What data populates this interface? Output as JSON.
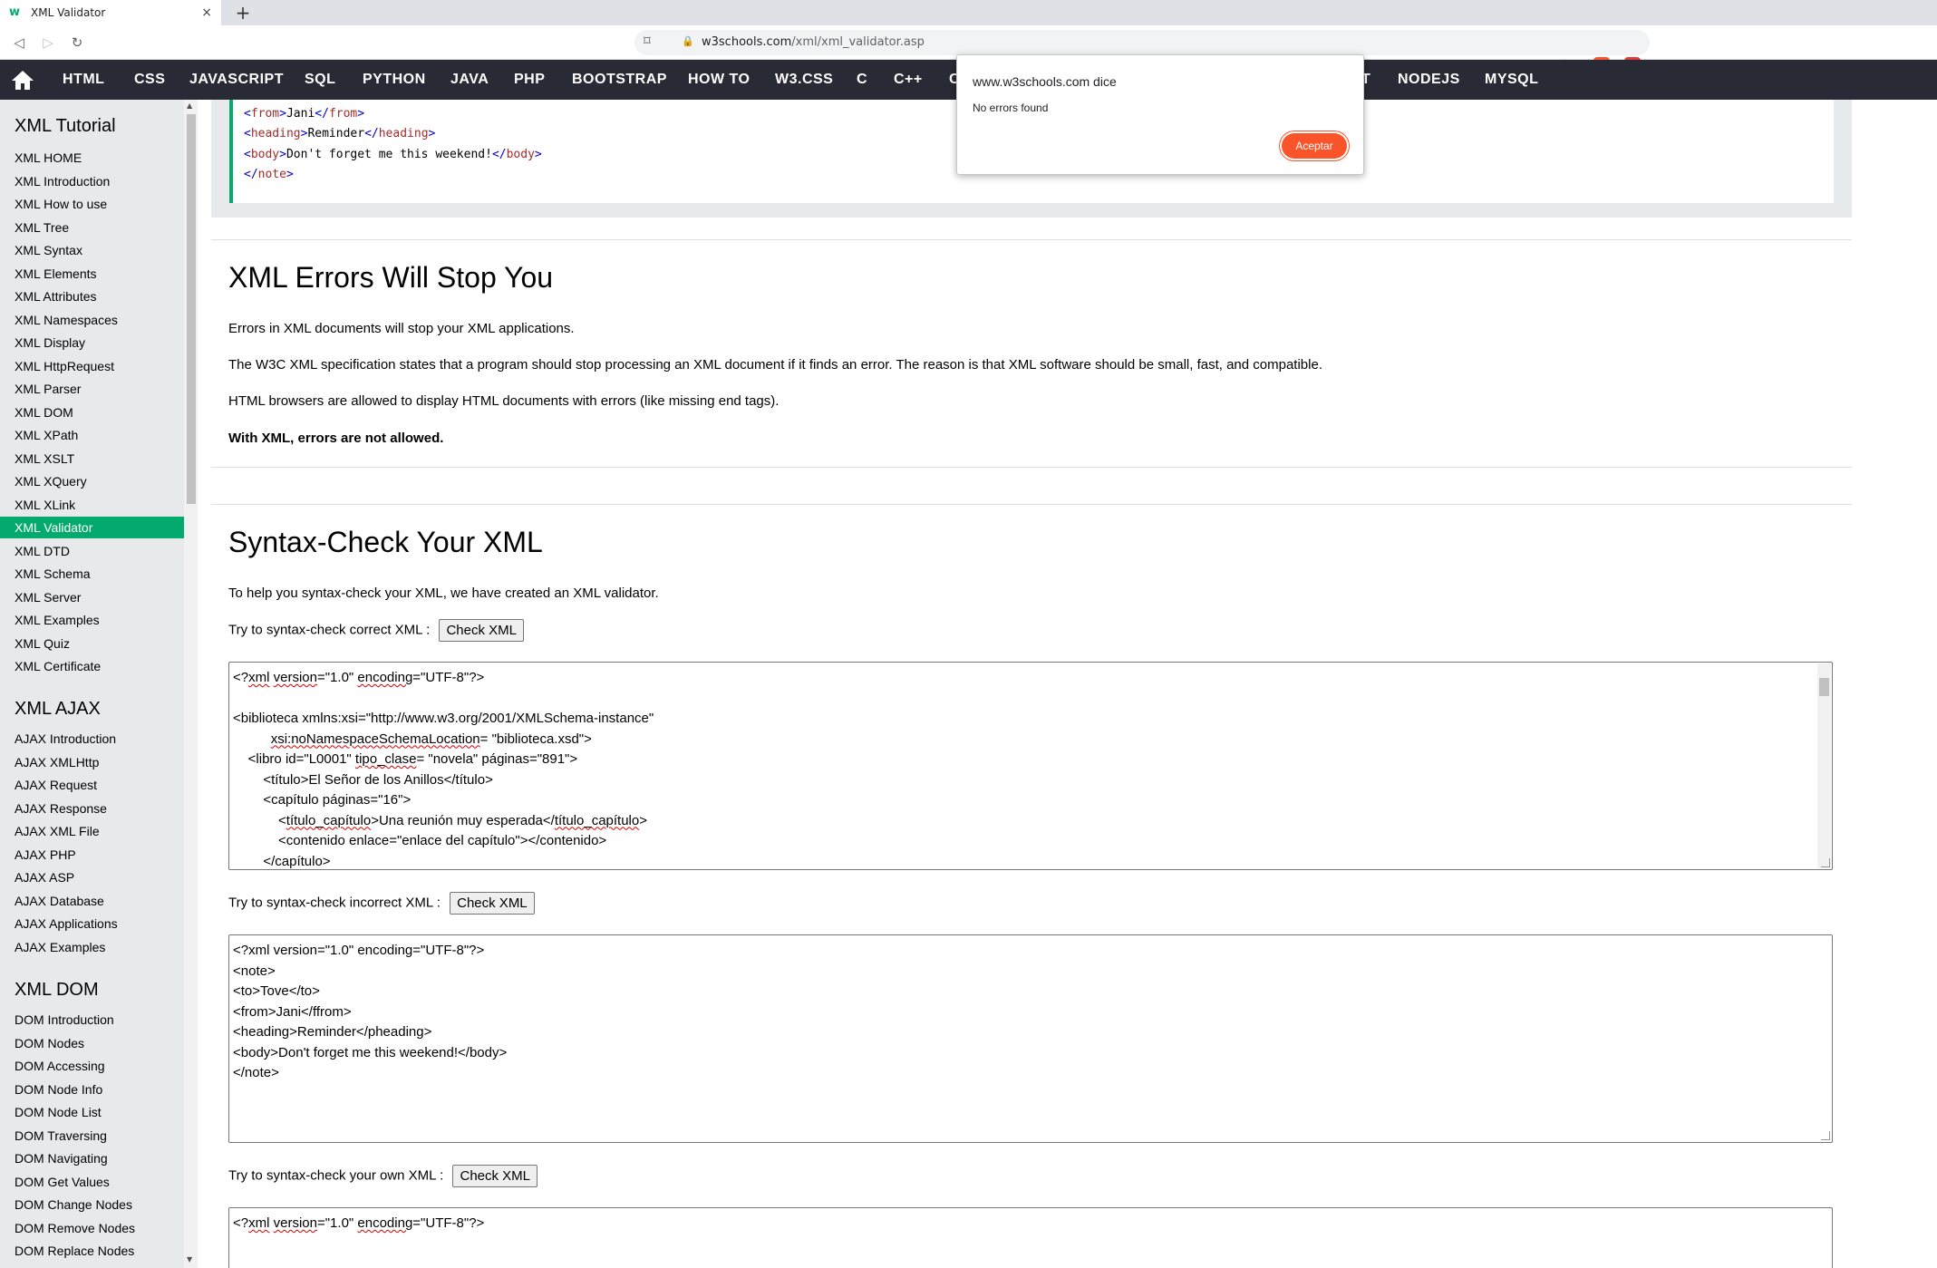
{
  "browser": {
    "tab_title": "XML Validator",
    "tab_close": "×",
    "new_tab": "+",
    "url_host": "w3schools.com",
    "url_path": "/xml/xml_validator.asp"
  },
  "topnav": {
    "items": [
      "HTML",
      "CSS",
      "JAVASCRIPT",
      "SQL",
      "PYTHON",
      "JAVA",
      "PHP",
      "BOOTSTRAP",
      "HOW TO",
      "W3.CSS",
      "C",
      "C++",
      "C",
      "T",
      "NODEJS",
      "MYSQL"
    ]
  },
  "sidebar": {
    "xml_tutorial_title": "XML Tutorial",
    "xml_items": [
      "XML HOME",
      "XML Introduction",
      "XML How to use",
      "XML Tree",
      "XML Syntax",
      "XML Elements",
      "XML Attributes",
      "XML Namespaces",
      "XML Display",
      "XML HttpRequest",
      "XML Parser",
      "XML DOM",
      "XML XPath",
      "XML XSLT",
      "XML XQuery",
      "XML XLink",
      "XML Validator",
      "XML DTD",
      "XML Schema",
      "XML Server",
      "XML Examples",
      "XML Quiz",
      "XML Certificate"
    ],
    "active_item": "XML Validator",
    "ajax_title": "XML AJAX",
    "ajax_items": [
      "AJAX Introduction",
      "AJAX XMLHttp",
      "AJAX Request",
      "AJAX Response",
      "AJAX XML File",
      "AJAX PHP",
      "AJAX ASP",
      "AJAX Database",
      "AJAX Applications",
      "AJAX Examples"
    ],
    "dom_title": "XML DOM",
    "dom_items": [
      "DOM Introduction",
      "DOM Nodes",
      "DOM Accessing",
      "DOM Node Info",
      "DOM Node List",
      "DOM Traversing",
      "DOM Navigating",
      "DOM Get Values",
      "DOM Change Nodes",
      "DOM Remove Nodes",
      "DOM Replace Nodes"
    ]
  },
  "example_code": {
    "line_from": "Jani",
    "line_heading": "Reminder",
    "line_body": "Don't forget me this weekend!"
  },
  "errors_section": {
    "title": "XML Errors Will Stop You",
    "p1": "Errors in XML documents will stop your XML applications.",
    "p2": "The W3C XML specification states that a program should stop processing an XML document if it finds an error. The reason is that XML software should be small, fast, and compatible.",
    "p3": "HTML browsers are allowed to display HTML documents with errors (like missing end tags).",
    "p4": "With XML, errors are not allowed."
  },
  "syntax_section": {
    "title": "Syntax-Check Your XML",
    "intro": "To help you syntax-check your XML, we have created an XML validator.",
    "correct_label": "Try to syntax-check correct XML :",
    "incorrect_label": "Try to syntax-check incorrect XML :",
    "own_label": "Try to syntax-check your own XML :",
    "check_button": "Check XML",
    "incorrect_xml": "<?xml version=\"1.0\" encoding=\"UTF-8\"?>\n<note>\n<to>Tove</to>\n<from>Jani</ffrom>\n<heading>Reminder</pheading>\n<body>Don't forget me this weekend!</body>\n</note>"
  },
  "dialog": {
    "title": "www.w3schools.com dice",
    "message": "No errors found",
    "button": "Aceptar"
  },
  "colors": {
    "accent": "#04aa6d",
    "nav_bg": "#282a35",
    "sidebar_bg": "#e7e9eb",
    "dialog_button": "#fb542b"
  }
}
